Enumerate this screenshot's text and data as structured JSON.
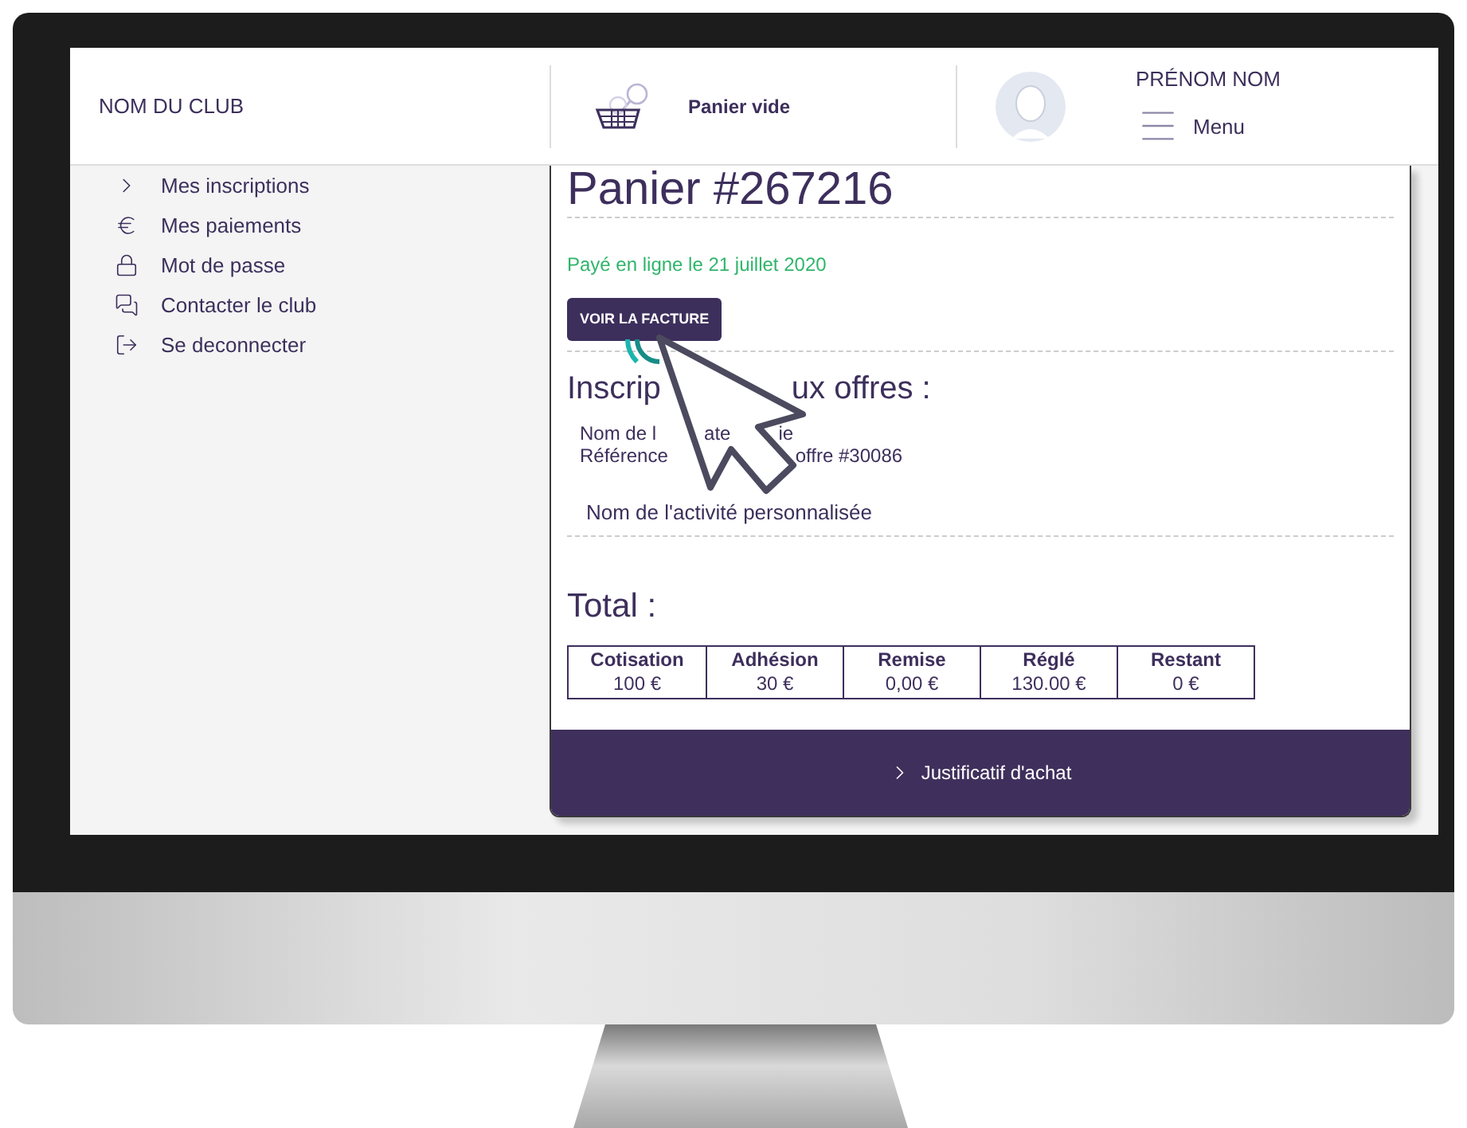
{
  "header": {
    "club_name": "NOM DU CLUB",
    "cart_label": "Panier vide",
    "user_name": "PRÉNOM NOM",
    "menu_label": "Menu"
  },
  "sidebar": {
    "items": [
      {
        "label": "Mes inscriptions",
        "kind": "chevron"
      },
      {
        "label": "Mes paiements",
        "kind": "euro"
      },
      {
        "label": "Mot de passe",
        "kind": "lock"
      },
      {
        "label": "Contacter le club",
        "kind": "chat"
      },
      {
        "label": "Se deconnecter",
        "kind": "logout"
      }
    ]
  },
  "cart": {
    "title": "Panier #267216",
    "payment_status": "Payé en ligne le 21 juillet 2020",
    "invoice_button": "VOIR LA FACTURE",
    "offers_heading_parts": [
      "Inscrip",
      "ux offres :"
    ],
    "offer_lines": [
      [
        "Nom de l",
        "ate",
        "ie"
      ],
      [
        "Référence",
        "offre #30086"
      ]
    ],
    "activity": "Nom de l'activité personnalisée",
    "total_heading": "Total :",
    "totals": [
      {
        "label": "Cotisation",
        "value": "100 €"
      },
      {
        "label": "Adhésion",
        "value": "30 €"
      },
      {
        "label": "Remise",
        "value": "0,00 €"
      },
      {
        "label": "Réglé",
        "value": "130.00 €"
      },
      {
        "label": "Restant",
        "value": "0 €"
      }
    ],
    "footer_link": "Justificatif d'achat"
  }
}
